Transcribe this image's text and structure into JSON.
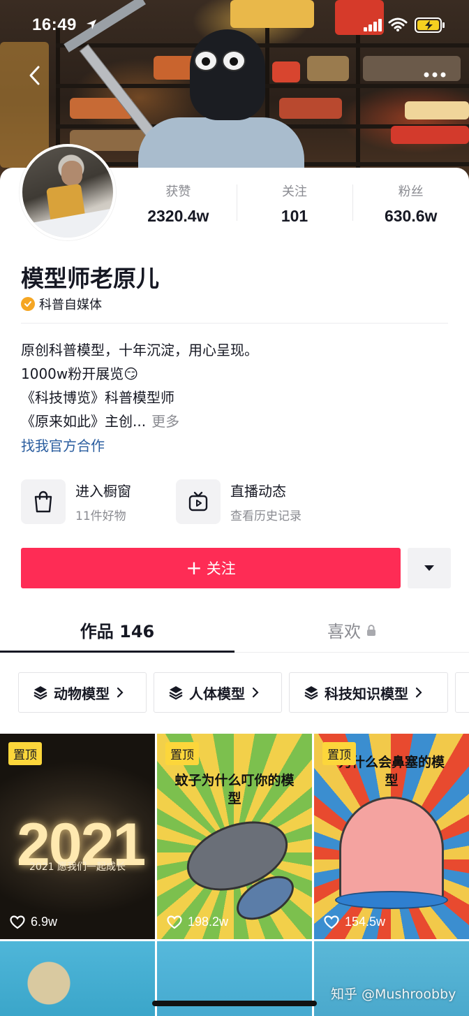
{
  "status_bar": {
    "time": "16:49"
  },
  "profile": {
    "name": "模型师老原儿",
    "verification": "科普自媒体",
    "stats": [
      {
        "label": "获赞",
        "value": "2320.4w"
      },
      {
        "label": "关注",
        "value": "101"
      },
      {
        "label": "粉丝",
        "value": "630.6w"
      }
    ],
    "bio_lines": [
      "原创科普模型，十年沉淀，用心呈现。",
      "1000w粉开展览😏",
      "《科技博览》科普模型师",
      "《原来如此》主创..."
    ],
    "bio_more": "更多",
    "partner_link": "找我官方合作"
  },
  "features": [
    {
      "title": "进入橱窗",
      "subtitle": "11件好物",
      "icon": "shopping-bag-icon"
    },
    {
      "title": "直播动态",
      "subtitle": "查看历史记录",
      "icon": "tv-icon"
    }
  ],
  "actions": {
    "follow_label": "关注"
  },
  "tabs": [
    {
      "label": "作品 146",
      "active": true
    },
    {
      "label": "喜欢",
      "active": false,
      "locked": true
    }
  ],
  "collections": [
    {
      "label": "动物模型"
    },
    {
      "label": "人体模型"
    },
    {
      "label": "科技知识模型"
    }
  ],
  "videos": [
    {
      "pinned": true,
      "pin_label": "置顶",
      "likes": "6.9w",
      "caption": "",
      "overlay_big": "2021",
      "overlay_sub": "2021 愿我们一起成长"
    },
    {
      "pinned": true,
      "pin_label": "置顶",
      "likes": "198.2w",
      "caption": "蚊子为什么叮你的模型"
    },
    {
      "pinned": true,
      "pin_label": "置顶",
      "likes": "154.5w",
      "caption": "为什么会鼻塞的模型"
    }
  ],
  "watermark": "知乎 @Mushroobby",
  "colors": {
    "primary": "#fe2c55",
    "link": "#2a5d9f",
    "pin": "#fcd63b",
    "verify": "#f5a623"
  }
}
